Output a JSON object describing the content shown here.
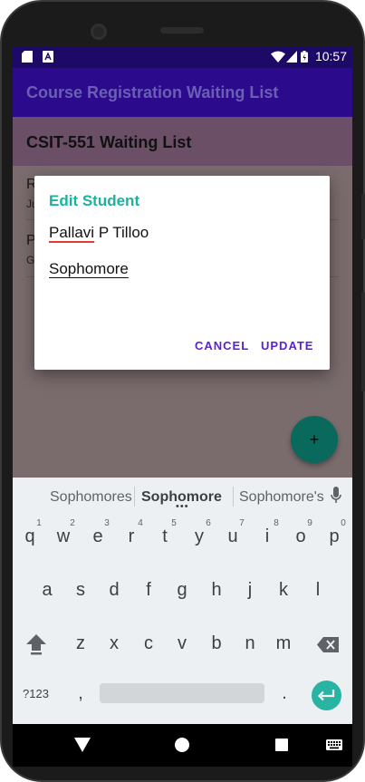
{
  "status_bar": {
    "time": "10:57"
  },
  "app_bar": {
    "title": "Course Registration Waiting List"
  },
  "list": {
    "header": "CSIT-551 Waiting List",
    "rows": [
      {
        "letter": "R",
        "sub": "Ju"
      },
      {
        "letter": "P",
        "sub": "G"
      }
    ]
  },
  "fab": {
    "label": "+"
  },
  "dialog": {
    "title": "Edit Student",
    "name_first": "Pallavi",
    "name_rest": " P Tilloo",
    "year_value": "Sophomore",
    "cancel_label": "CANCEL",
    "update_label": "UPDATE"
  },
  "keyboard": {
    "suggestions": [
      "Sophomores",
      "Sophomore",
      "Sophomore's"
    ],
    "suggestion_more": "•••",
    "row1": [
      "q",
      "w",
      "e",
      "r",
      "t",
      "y",
      "u",
      "i",
      "o",
      "p"
    ],
    "row1_hints": [
      "1",
      "2",
      "3",
      "4",
      "5",
      "6",
      "7",
      "8",
      "9",
      "0"
    ],
    "row2": [
      "a",
      "s",
      "d",
      "f",
      "g",
      "h",
      "j",
      "k",
      "l"
    ],
    "row3": [
      "z",
      "x",
      "c",
      "v",
      "b",
      "n",
      "m"
    ],
    "symbols_label": "?123",
    "comma": ",",
    "period": "."
  },
  "colors": {
    "app_bar": "#2c0a8c",
    "dialog_title": "#19b3a0",
    "dialog_buttons": "#5b1fd6",
    "fab": "#08695c",
    "enter_key": "#29b3a3"
  }
}
